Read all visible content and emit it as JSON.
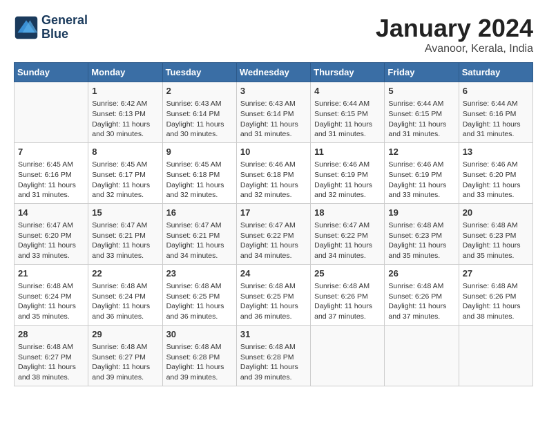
{
  "logo": {
    "line1": "General",
    "line2": "Blue"
  },
  "title": "January 2024",
  "location": "Avanoor, Kerala, India",
  "headers": [
    "Sunday",
    "Monday",
    "Tuesday",
    "Wednesday",
    "Thursday",
    "Friday",
    "Saturday"
  ],
  "weeks": [
    [
      {
        "day": "",
        "info": ""
      },
      {
        "day": "1",
        "info": "Sunrise: 6:42 AM\nSunset: 6:13 PM\nDaylight: 11 hours\nand 30 minutes."
      },
      {
        "day": "2",
        "info": "Sunrise: 6:43 AM\nSunset: 6:14 PM\nDaylight: 11 hours\nand 30 minutes."
      },
      {
        "day": "3",
        "info": "Sunrise: 6:43 AM\nSunset: 6:14 PM\nDaylight: 11 hours\nand 31 minutes."
      },
      {
        "day": "4",
        "info": "Sunrise: 6:44 AM\nSunset: 6:15 PM\nDaylight: 11 hours\nand 31 minutes."
      },
      {
        "day": "5",
        "info": "Sunrise: 6:44 AM\nSunset: 6:15 PM\nDaylight: 11 hours\nand 31 minutes."
      },
      {
        "day": "6",
        "info": "Sunrise: 6:44 AM\nSunset: 6:16 PM\nDaylight: 11 hours\nand 31 minutes."
      }
    ],
    [
      {
        "day": "7",
        "info": "Sunrise: 6:45 AM\nSunset: 6:16 PM\nDaylight: 11 hours\nand 31 minutes."
      },
      {
        "day": "8",
        "info": "Sunrise: 6:45 AM\nSunset: 6:17 PM\nDaylight: 11 hours\nand 32 minutes."
      },
      {
        "day": "9",
        "info": "Sunrise: 6:45 AM\nSunset: 6:18 PM\nDaylight: 11 hours\nand 32 minutes."
      },
      {
        "day": "10",
        "info": "Sunrise: 6:46 AM\nSunset: 6:18 PM\nDaylight: 11 hours\nand 32 minutes."
      },
      {
        "day": "11",
        "info": "Sunrise: 6:46 AM\nSunset: 6:19 PM\nDaylight: 11 hours\nand 32 minutes."
      },
      {
        "day": "12",
        "info": "Sunrise: 6:46 AM\nSunset: 6:19 PM\nDaylight: 11 hours\nand 33 minutes."
      },
      {
        "day": "13",
        "info": "Sunrise: 6:46 AM\nSunset: 6:20 PM\nDaylight: 11 hours\nand 33 minutes."
      }
    ],
    [
      {
        "day": "14",
        "info": "Sunrise: 6:47 AM\nSunset: 6:20 PM\nDaylight: 11 hours\nand 33 minutes."
      },
      {
        "day": "15",
        "info": "Sunrise: 6:47 AM\nSunset: 6:21 PM\nDaylight: 11 hours\nand 33 minutes."
      },
      {
        "day": "16",
        "info": "Sunrise: 6:47 AM\nSunset: 6:21 PM\nDaylight: 11 hours\nand 34 minutes."
      },
      {
        "day": "17",
        "info": "Sunrise: 6:47 AM\nSunset: 6:22 PM\nDaylight: 11 hours\nand 34 minutes."
      },
      {
        "day": "18",
        "info": "Sunrise: 6:47 AM\nSunset: 6:22 PM\nDaylight: 11 hours\nand 34 minutes."
      },
      {
        "day": "19",
        "info": "Sunrise: 6:48 AM\nSunset: 6:23 PM\nDaylight: 11 hours\nand 35 minutes."
      },
      {
        "day": "20",
        "info": "Sunrise: 6:48 AM\nSunset: 6:23 PM\nDaylight: 11 hours\nand 35 minutes."
      }
    ],
    [
      {
        "day": "21",
        "info": "Sunrise: 6:48 AM\nSunset: 6:24 PM\nDaylight: 11 hours\nand 35 minutes."
      },
      {
        "day": "22",
        "info": "Sunrise: 6:48 AM\nSunset: 6:24 PM\nDaylight: 11 hours\nand 36 minutes."
      },
      {
        "day": "23",
        "info": "Sunrise: 6:48 AM\nSunset: 6:25 PM\nDaylight: 11 hours\nand 36 minutes."
      },
      {
        "day": "24",
        "info": "Sunrise: 6:48 AM\nSunset: 6:25 PM\nDaylight: 11 hours\nand 36 minutes."
      },
      {
        "day": "25",
        "info": "Sunrise: 6:48 AM\nSunset: 6:26 PM\nDaylight: 11 hours\nand 37 minutes."
      },
      {
        "day": "26",
        "info": "Sunrise: 6:48 AM\nSunset: 6:26 PM\nDaylight: 11 hours\nand 37 minutes."
      },
      {
        "day": "27",
        "info": "Sunrise: 6:48 AM\nSunset: 6:26 PM\nDaylight: 11 hours\nand 38 minutes."
      }
    ],
    [
      {
        "day": "28",
        "info": "Sunrise: 6:48 AM\nSunset: 6:27 PM\nDaylight: 11 hours\nand 38 minutes."
      },
      {
        "day": "29",
        "info": "Sunrise: 6:48 AM\nSunset: 6:27 PM\nDaylight: 11 hours\nand 39 minutes."
      },
      {
        "day": "30",
        "info": "Sunrise: 6:48 AM\nSunset: 6:28 PM\nDaylight: 11 hours\nand 39 minutes."
      },
      {
        "day": "31",
        "info": "Sunrise: 6:48 AM\nSunset: 6:28 PM\nDaylight: 11 hours\nand 39 minutes."
      },
      {
        "day": "",
        "info": ""
      },
      {
        "day": "",
        "info": ""
      },
      {
        "day": "",
        "info": ""
      }
    ]
  ]
}
